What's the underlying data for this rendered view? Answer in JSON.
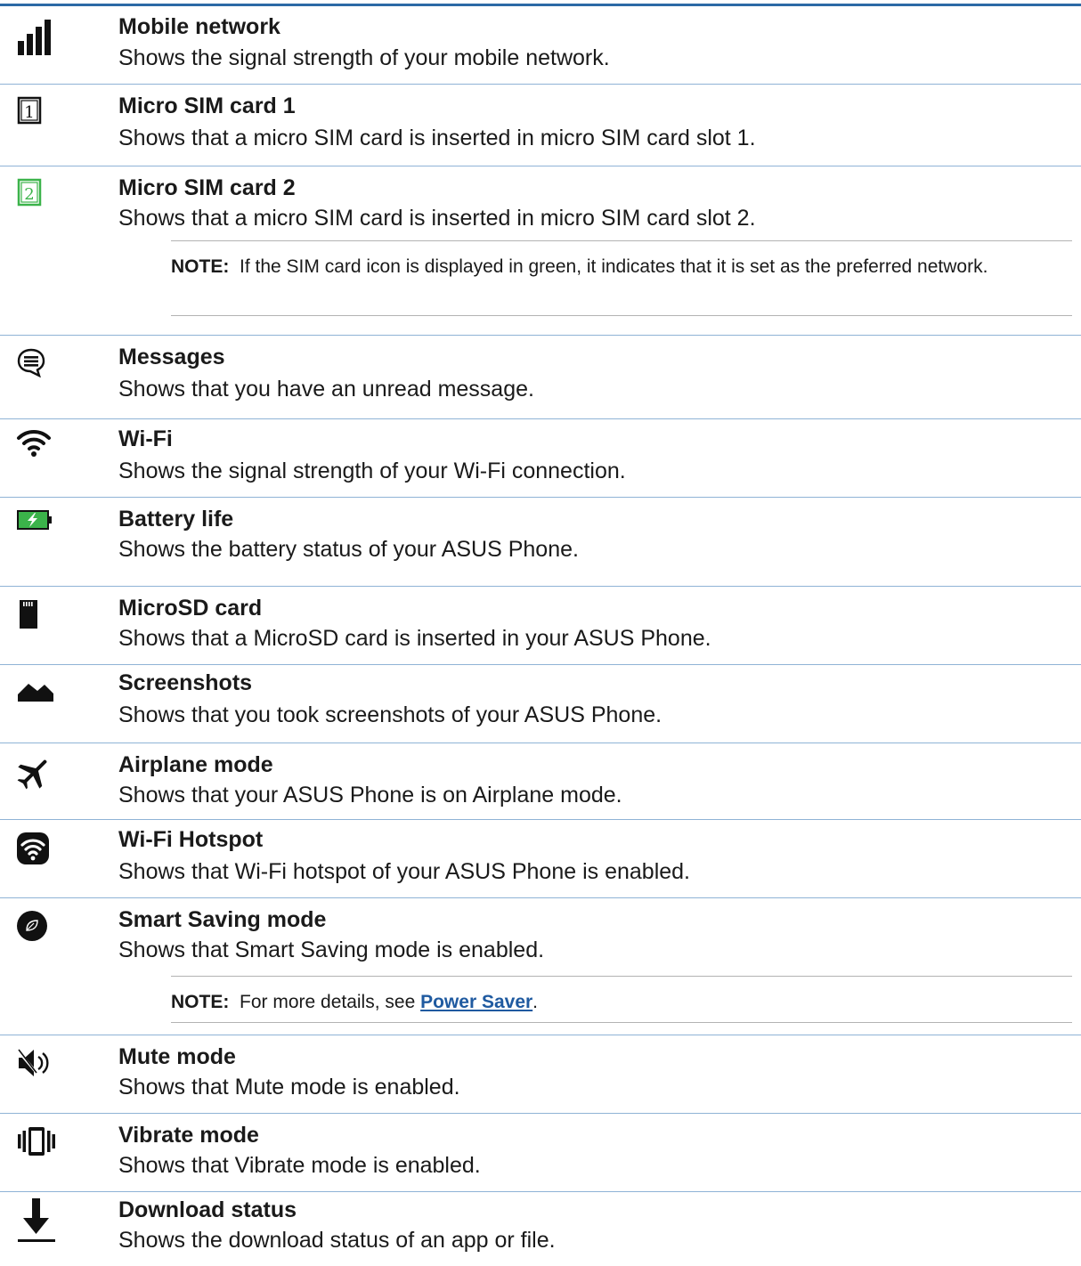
{
  "items": [
    {
      "icon": "signal-bars-icon",
      "title": "Mobile network",
      "desc": "Shows the signal strength of your mobile network."
    },
    {
      "icon": "sim-card-1-icon",
      "title": "Micro SIM card 1",
      "desc": "Shows that a micro SIM card is inserted in micro SIM card slot 1."
    },
    {
      "icon": "sim-card-2-icon",
      "title": "Micro SIM card 2",
      "desc": "Shows that a micro SIM card is inserted in micro SIM card slot 2."
    },
    {
      "icon": "message-bubble-icon",
      "title": "Messages",
      "desc": "Shows that you have an unread message."
    },
    {
      "icon": "wifi-icon",
      "title": "Wi-Fi",
      "desc": "Shows the signal strength of your Wi-Fi connection."
    },
    {
      "icon": "battery-charging-icon",
      "title": "Battery life",
      "desc": "Shows the battery status of your ASUS Phone."
    },
    {
      "icon": "microsd-card-icon",
      "title": "MicroSD card",
      "desc": "Shows that a MicroSD card is inserted in your ASUS Phone."
    },
    {
      "icon": "screenshot-image-icon",
      "title": "Screenshots",
      "desc": "Shows that you took screenshots of your ASUS Phone."
    },
    {
      "icon": "airplane-icon",
      "title": "Airplane mode",
      "desc": "Shows that your ASUS Phone is on Airplane mode."
    },
    {
      "icon": "wifi-hotspot-icon",
      "title": "Wi-Fi Hotspot",
      "desc": "Shows that Wi-Fi hotspot of your ASUS Phone is enabled."
    },
    {
      "icon": "leaf-circle-icon",
      "title": "Smart Saving mode",
      "desc": "Shows that Smart Saving mode is enabled."
    },
    {
      "icon": "speaker-mute-icon",
      "title": "Mute mode",
      "desc": "Shows that Mute mode is enabled."
    },
    {
      "icon": "vibrate-phone-icon",
      "title": "Vibrate mode",
      "desc": "Shows that Vibrate mode is enabled."
    },
    {
      "icon": "download-arrow-icon",
      "title": "Download status",
      "desc": "Shows the download status of an app or file."
    }
  ],
  "notes": {
    "sim_note_label": "NOTE:",
    "sim_note_text": "If the SIM card icon is displayed in green, it indicates that it is set as the preferred network.",
    "saver_note_label": "NOTE:",
    "saver_note_text": "For more details, see",
    "saver_note_link": "Power Saver",
    "saver_note_end": "."
  },
  "colors": {
    "rule_blue": "#2c6aa6",
    "separator": "#8fb3d6",
    "sim2_green": "#3bb34a",
    "battery_green": "#3bb34a",
    "link_blue": "#1f5aa0"
  }
}
